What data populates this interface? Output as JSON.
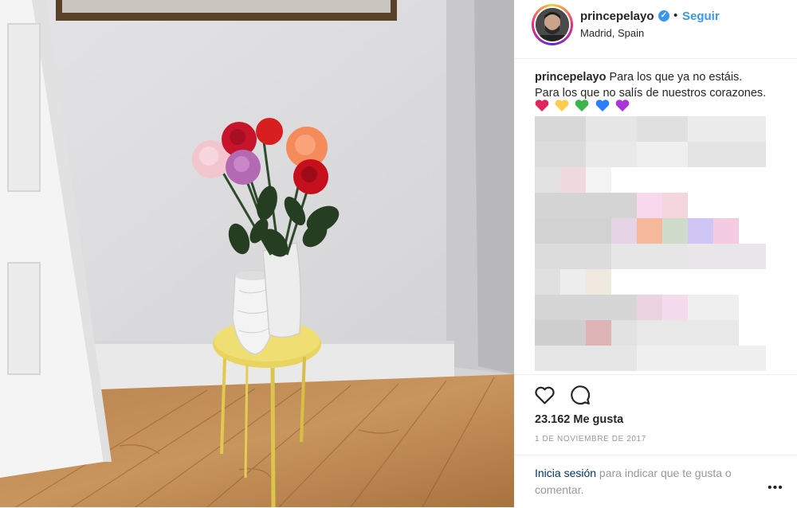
{
  "post": {
    "username": "princepelayo",
    "verified_glyph": "✓",
    "separator": "•",
    "follow_label": "Seguir",
    "location": "Madrid, Spain",
    "caption_user": "princepelayo",
    "caption_line1": "Para los que ya no estáis.",
    "caption_line2": "Para los que no salís de nuestros corazones.",
    "caption_emojis": [
      "red-heart-icon",
      "yellow-heart-icon",
      "green-heart-icon",
      "blue-heart-icon",
      "purple-heart-icon"
    ],
    "likes_text": "23.162 Me gusta",
    "date_text": "1 DE NOVIEMBRE DE 2017",
    "login_link": "Inicia sesión",
    "login_rest": " para indicar que te gusta o comentar.",
    "more_label": "•••"
  },
  "icons": {
    "like": "heart-outline-icon",
    "comment": "comment-bubble-icon",
    "options": "more-options-icon"
  },
  "colors": {
    "accent": "#3897f0",
    "text": "#262626",
    "muted": "#999999",
    "link": "#003569",
    "emoji_red": "#e0245e",
    "emoji_yellow": "#ffcc4d",
    "emoji_green": "#3bb54a",
    "emoji_blue": "#2a7fff",
    "emoji_purple": "#aa33dd"
  }
}
